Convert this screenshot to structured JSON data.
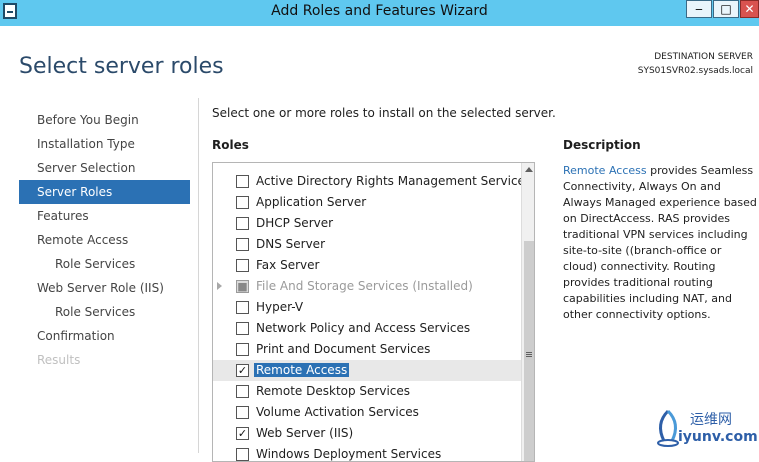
{
  "window": {
    "title": "Add Roles and Features Wizard",
    "min_glyph": "‒",
    "max_glyph": "□",
    "close_glyph": "✕"
  },
  "header": {
    "page_title": "Select server roles",
    "destination_label": "DESTINATION SERVER",
    "destination_value": "SYS01SVR02.sysads.local"
  },
  "nav": {
    "items": [
      {
        "label": "Before You Begin",
        "state": "normal"
      },
      {
        "label": "Installation Type",
        "state": "normal"
      },
      {
        "label": "Server Selection",
        "state": "normal"
      },
      {
        "label": "Server Roles",
        "state": "active"
      },
      {
        "label": "Features",
        "state": "normal"
      },
      {
        "label": "Remote Access",
        "state": "normal"
      },
      {
        "label": "Role Services",
        "state": "sub"
      },
      {
        "label": "Web Server Role (IIS)",
        "state": "normal"
      },
      {
        "label": "Role Services",
        "state": "sub"
      },
      {
        "label": "Confirmation",
        "state": "normal"
      },
      {
        "label": "Results",
        "state": "disabled"
      }
    ]
  },
  "main": {
    "instruction": "Select one or more roles to install on the selected server.",
    "roles_label": "Roles",
    "roles": [
      {
        "label": "Active Directory Rights Management Services",
        "checked": false
      },
      {
        "label": "Application Server",
        "checked": false
      },
      {
        "label": "DHCP Server",
        "checked": false
      },
      {
        "label": "DNS Server",
        "checked": false
      },
      {
        "label": "Fax Server",
        "checked": false
      },
      {
        "label": "File And Storage Services (Installed)",
        "checked": true,
        "disabled": true,
        "expandable": true
      },
      {
        "label": "Hyper-V",
        "checked": false
      },
      {
        "label": "Network Policy and Access Services",
        "checked": false
      },
      {
        "label": "Print and Document Services",
        "checked": false
      },
      {
        "label": "Remote Access",
        "checked": true,
        "selected": true
      },
      {
        "label": "Remote Desktop Services",
        "checked": false
      },
      {
        "label": "Volume Activation Services",
        "checked": false
      },
      {
        "label": "Web Server (IIS)",
        "checked": true
      },
      {
        "label": "Windows Deployment Services",
        "checked": false
      }
    ],
    "check_glyph": "✓",
    "filled_glyph": "■"
  },
  "description": {
    "label": "Description",
    "link_text": "Remote Access",
    "body": " provides Seamless Connectivity, Always On and Always Managed experience based on DirectAccess. RAS provides traditional VPN services including site-to-site ((branch-office or cloud) connectivity. Routing provides traditional routing capabilities including NAT, and other connectivity options."
  },
  "watermark": {
    "cn_text": "运维网",
    "en_text": "iyunv.com"
  },
  "colors": {
    "titlebar": "#5fc8ef",
    "accent": "#2b71b4",
    "page_title": "#2b4a6a"
  }
}
